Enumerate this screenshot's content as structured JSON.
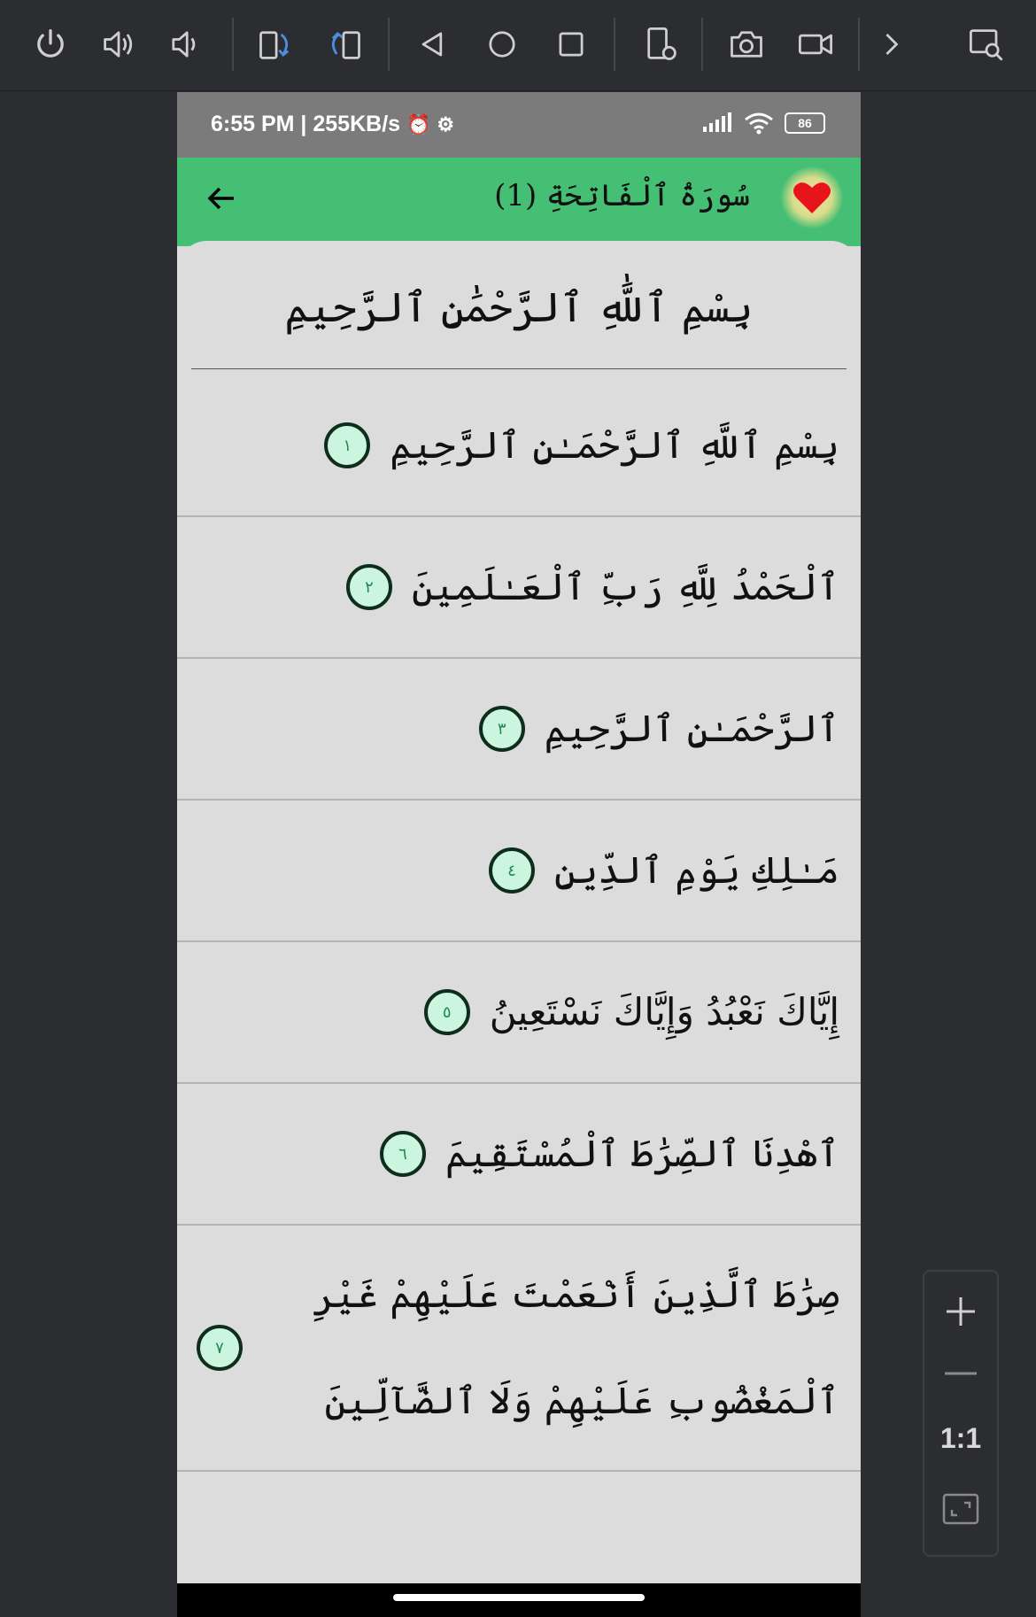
{
  "toolbar": {
    "icons": [
      "power-icon",
      "volume-up-icon",
      "volume-down-icon",
      "rotate-left-icon",
      "rotate-right-icon",
      "back-triangle-icon",
      "home-circle-icon",
      "overview-square-icon",
      "device-settings-icon",
      "camera-icon",
      "video-record-icon",
      "chevron-right-icon",
      "inspect-window-icon"
    ]
  },
  "status_bar": {
    "time_network": "6:55 PM | 255KB/s",
    "battery": "86"
  },
  "app_bar": {
    "title": "سُورَةُ ٱلْفَاتِحَةِ (1)",
    "favorite_icon": "heart-icon",
    "favorite_color": "#e8141b",
    "accent": "#45bf74"
  },
  "basmala": "بِسْمِ ٱللَّٰهِ ٱلرَّحْمَٰنِ ٱلرَّحِيمِ",
  "ayahs": [
    {
      "text": "بِسْمِ ٱللَّهِ ٱلرَّحْمَـٰنِ ٱلرَّحِيمِ",
      "number": "١"
    },
    {
      "text": "ٱلْحَمْدُ لِلَّهِ رَبِّ ٱلْعَـٰلَمِينَ",
      "number": "٢"
    },
    {
      "text": "ٱلرَّحْمَـٰنِ ٱلرَّحِيمِ",
      "number": "٣"
    },
    {
      "text": "مَـٰلِكِ يَوْمِ ٱلدِّينِ",
      "number": "٤"
    },
    {
      "text": "إِيَّاكَ نَعْبُدُ وَإِيَّاكَ نَسْتَعِينُ",
      "number": "٥"
    },
    {
      "text": "ٱهْدِنَا ٱلصِّرَٰطَ ٱلْمُسْتَقِيمَ",
      "number": "٦"
    },
    {
      "text": "صِرَٰطَ ٱلَّذِينَ أَنْعَمْتَ عَلَيْهِمْ غَيْرِ ٱلْمَغْضُوبِ عَلَيْهِمْ وَلَا ٱلضَّآلِّينَ",
      "number": "٧"
    }
  ],
  "zoom": {
    "ratio_label": "1:1"
  }
}
